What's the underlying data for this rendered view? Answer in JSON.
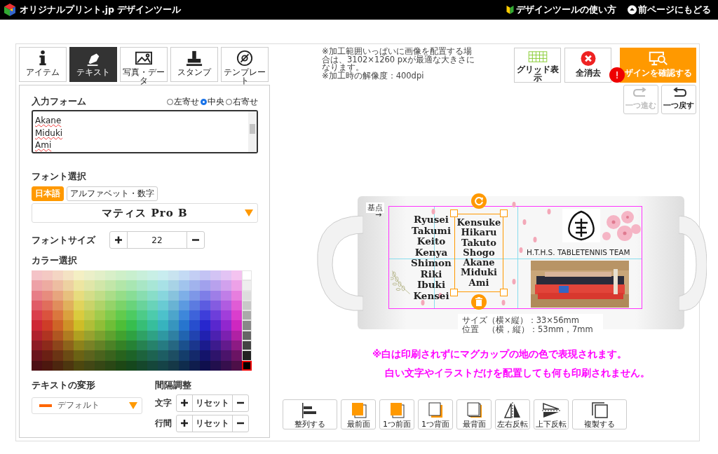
{
  "header": {
    "logo_text": "オリジナルプリント.jp デザインツール",
    "links": [
      {
        "label": "デザインツールの使い方",
        "kind": "guide"
      },
      {
        "label": "前ページにもどる",
        "kind": "back"
      }
    ]
  },
  "tabs": [
    {
      "label": "アイテム",
      "kind": "item",
      "selected": false
    },
    {
      "label": "テキスト",
      "kind": "text",
      "selected": true
    },
    {
      "label": "写真・データ",
      "selected": false
    },
    {
      "label": "スタンプ",
      "kind": "stamp",
      "selected": false
    },
    {
      "label": "テンプレート",
      "kind": "template",
      "selected": false
    }
  ],
  "text_panel": {
    "input_label": "入力フォーム",
    "alignment": [
      {
        "label": "左寄せ",
        "selected": false
      },
      {
        "label": "中央",
        "selected": true
      },
      {
        "label": "右寄せ",
        "selected": false
      }
    ],
    "input_lines": [
      "Akane",
      "Miduki",
      "Ami"
    ],
    "font_label": "フォント選択",
    "font_tabs": [
      {
        "label": "日本語",
        "selected": true
      },
      {
        "label": "アルファベット・数字",
        "selected": false
      }
    ],
    "font": "マティス Pro B",
    "size_label": "フォントサイズ",
    "size": "22",
    "color_label": "カラー選択",
    "gray_swatches": [
      {
        "color": "#ffffff",
        "selected": false
      },
      {
        "color": "#eeeeee",
        "selected": false
      },
      {
        "color": "#dddddd",
        "selected": false
      },
      {
        "color": "#c8c8c8",
        "selected": false
      },
      {
        "color": "#aaaaaa",
        "selected": false
      },
      {
        "color": "#888888",
        "selected": false
      },
      {
        "color": "#666666",
        "selected": false
      },
      {
        "color": "#444444",
        "selected": false
      },
      {
        "color": "#222222",
        "selected": false
      },
      {
        "color": "#000000",
        "selected": true
      }
    ],
    "transform_label": "テキストの変形",
    "transform": "デフォルト",
    "spacing_label": "間隔調整",
    "spacing": [
      {
        "label": "文字",
        "reset": "リセット"
      },
      {
        "label": "行間",
        "reset": "リセット"
      }
    ]
  },
  "notes": [
    "※加工範囲いっぱいに画像を配置する場合は、3102×1260 pxが最適な大きさになります。",
    "※加工時の解像度：400dpi"
  ],
  "top_buttons": [
    {
      "label": "グリッド表示",
      "kind": "grid"
    },
    {
      "label": "全消去",
      "kind": "clear"
    },
    {
      "label": "ザインを確認する",
      "kind": "confirm",
      "badge": "!"
    }
  ],
  "history": [
    {
      "label": "一つ進む",
      "kind": "redo",
      "disabled": true
    },
    {
      "label": "一つ戻す",
      "kind": "undo",
      "disabled": false
    }
  ],
  "canvas": {
    "base_label": "基点",
    "base_arrow": "→",
    "column_1": [
      "Ryusei",
      "Takumi",
      "Keito",
      "Kenya",
      "Shimon",
      "Riki",
      "Ibuki",
      "Kensei"
    ],
    "column_2": [
      "Kensuke",
      "Hikaru",
      "Takuto",
      "Shogo",
      "Akane",
      "Miduki",
      "Ami"
    ],
    "team_text": "H.T.H.S. TABLETENNIS TEAM",
    "size": "サイズ（横×縦）：33×56mm",
    "position": "位置　（横，縦）：53mm，7mm"
  },
  "warnings": [
    "※白は印刷されずにマグカップの地の色で表現されます。",
    "白い文字やイラストだけを配置しても何も印刷されません。"
  ],
  "toolbar": [
    {
      "label": "整列する",
      "kind": "align"
    },
    {
      "label": "最前面",
      "kind": "front"
    },
    {
      "label": "1つ前面",
      "kind": "forward"
    },
    {
      "label": "1つ背面",
      "kind": "backward"
    },
    {
      "label": "最背面",
      "kind": "back"
    },
    {
      "label": "左右反転",
      "kind": "fliph"
    },
    {
      "label": "上下反転",
      "kind": "flipv"
    },
    {
      "label": "複製する",
      "kind": "duplicate"
    }
  ]
}
